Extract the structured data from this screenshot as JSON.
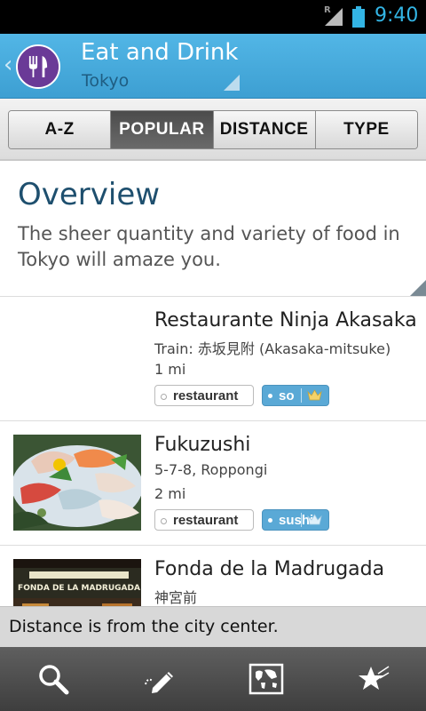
{
  "status": {
    "roaming": "R",
    "time": "9:40"
  },
  "actionbar": {
    "title": "Eat and Drink",
    "subtitle": "Tokyo",
    "icons": [
      "back-chevron-icon",
      "fork-knife-icon",
      "dropdown-triangle-icon"
    ]
  },
  "tabs": [
    {
      "label": "A-Z",
      "active": false
    },
    {
      "label": "POPULAR",
      "active": true
    },
    {
      "label": "DISTANCE",
      "active": false
    },
    {
      "label": "TYPE",
      "active": false
    }
  ],
  "overview": {
    "title": "Overview",
    "text": "The sheer quantity and variety of food in Tokyo will amaze you."
  },
  "items": [
    {
      "name": "Restaurante Ninja Akasaka",
      "address": "Train: 赤坂見附 (Akasaka-mitsuke)",
      "distance": "1 mi",
      "tag": "restaurant",
      "subtag": "so"
    },
    {
      "name": "Fukuzushi",
      "address": "5-7-8, Roppongi",
      "distance": "2 mi",
      "tag": "restaurant",
      "subtag": "sushi"
    },
    {
      "name": "Fonda de la Madrugada",
      "address": "神宮前",
      "sign_text": "FONDA DE LA MADRUGADA"
    }
  ],
  "toast": "Distance is from the city center.",
  "bottombar": {
    "icons": [
      "search-icon",
      "pen-icon",
      "world-map-icon",
      "star-icon"
    ]
  },
  "colors": {
    "actionbar": "#4aa9dc",
    "title_blue": "#1e4f6e",
    "tag_blue": "#5aa9d6",
    "time": "#33b5e5",
    "app_icon": "#6a3a97"
  }
}
